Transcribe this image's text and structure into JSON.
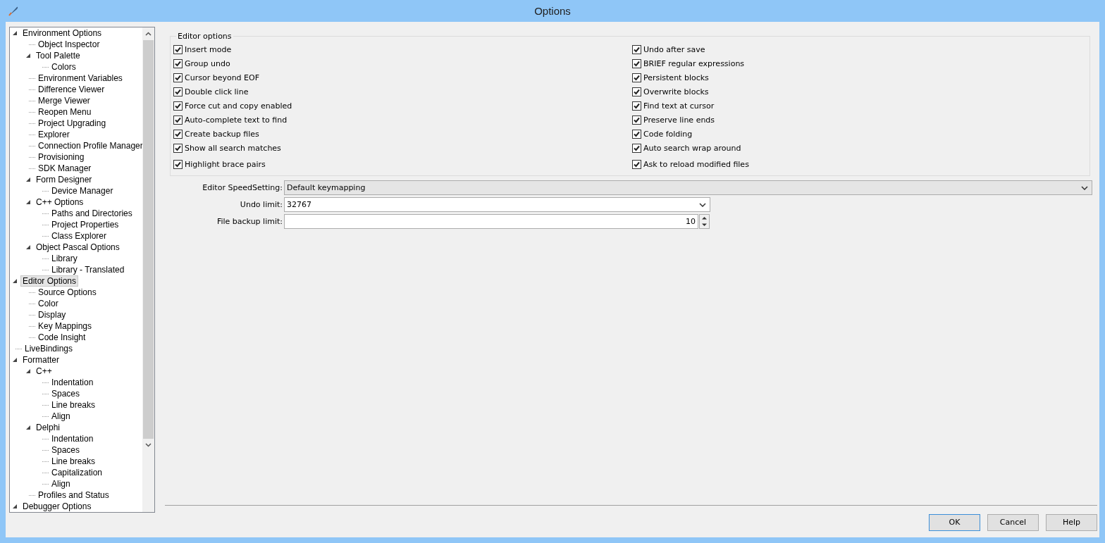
{
  "window": {
    "title": "Options"
  },
  "tree": [
    {
      "label": "Environment Options",
      "selected": false,
      "expanded": true,
      "children": [
        {
          "label": "Object Inspector",
          "selected": false
        },
        {
          "label": "Tool Palette",
          "selected": false,
          "expanded": true,
          "children": [
            {
              "label": "Colors",
              "selected": false
            }
          ]
        },
        {
          "label": "Environment Variables",
          "selected": false
        },
        {
          "label": "Difference Viewer",
          "selected": false
        },
        {
          "label": "Merge Viewer",
          "selected": false
        },
        {
          "label": "Reopen Menu",
          "selected": false
        },
        {
          "label": "Project Upgrading",
          "selected": false
        },
        {
          "label": "Explorer",
          "selected": false
        },
        {
          "label": "Connection Profile Manager",
          "selected": false
        },
        {
          "label": "Provisioning",
          "selected": false
        },
        {
          "label": "SDK Manager",
          "selected": false
        },
        {
          "label": "Form Designer",
          "selected": false,
          "expanded": true,
          "children": [
            {
              "label": "Device Manager",
              "selected": false
            }
          ]
        },
        {
          "label": "C++ Options",
          "selected": false,
          "expanded": true,
          "children": [
            {
              "label": "Paths and Directories",
              "selected": false
            },
            {
              "label": "Project Properties",
              "selected": false
            },
            {
              "label": "Class Explorer",
              "selected": false
            }
          ]
        },
        {
          "label": "Object Pascal Options",
          "selected": false,
          "expanded": true,
          "children": [
            {
              "label": "Library",
              "selected": false
            },
            {
              "label": "Library - Translated",
              "selected": false
            }
          ]
        }
      ]
    },
    {
      "label": "Editor Options",
      "selected": true,
      "expanded": true,
      "children": [
        {
          "label": "Source Options",
          "selected": false
        },
        {
          "label": "Color",
          "selected": false
        },
        {
          "label": "Display",
          "selected": false
        },
        {
          "label": "Key Mappings",
          "selected": false
        },
        {
          "label": "Code Insight",
          "selected": false
        }
      ]
    },
    {
      "label": "LiveBindings",
      "selected": false
    },
    {
      "label": "Formatter",
      "selected": false,
      "expanded": true,
      "children": [
        {
          "label": "C++",
          "selected": false,
          "expanded": true,
          "children": [
            {
              "label": "Indentation",
              "selected": false
            },
            {
              "label": "Spaces",
              "selected": false
            },
            {
              "label": "Line breaks",
              "selected": false
            },
            {
              "label": "Align",
              "selected": false
            }
          ]
        },
        {
          "label": "Delphi",
          "selected": false,
          "expanded": true,
          "children": [
            {
              "label": "Indentation",
              "selected": false
            },
            {
              "label": "Spaces",
              "selected": false
            },
            {
              "label": "Line breaks",
              "selected": false
            },
            {
              "label": "Capitalization",
              "selected": false
            },
            {
              "label": "Align",
              "selected": false
            }
          ]
        },
        {
          "label": "Profiles and Status",
          "selected": false
        }
      ]
    },
    {
      "label": "Debugger Options",
      "selected": false,
      "expanded": true
    }
  ],
  "editor_options": {
    "title": "Editor options",
    "checkboxes": [
      {
        "label": "Insert mode",
        "checked": true
      },
      {
        "label": "Undo after save",
        "checked": true
      },
      {
        "label": "Group undo",
        "checked": true
      },
      {
        "label": "BRIEF regular expressions",
        "checked": true
      },
      {
        "label": "Cursor beyond EOF",
        "checked": true
      },
      {
        "label": "Persistent blocks",
        "checked": true
      },
      {
        "label": "Double click line",
        "checked": true
      },
      {
        "label": "Overwrite blocks",
        "checked": true
      },
      {
        "label": "Force cut and copy enabled",
        "checked": true
      },
      {
        "label": "Find text at cursor",
        "checked": true
      },
      {
        "label": "Auto-complete text to find",
        "checked": true
      },
      {
        "label": "Preserve line ends",
        "checked": true
      },
      {
        "label": "Create backup files",
        "checked": true
      },
      {
        "label": "Code folding",
        "checked": true
      },
      {
        "label": "Show all search matches",
        "checked": true
      },
      {
        "label": "Auto search wrap around",
        "checked": true
      },
      {
        "label": "Highlight brace pairs",
        "checked": true
      },
      {
        "label": "Ask to reload modified files",
        "checked": true
      }
    ]
  },
  "fields": [
    {
      "kind": "readonly-dropdown",
      "label": "Editor SpeedSetting:",
      "value": "Default keymapping"
    },
    {
      "kind": "dropdown",
      "label": "Undo limit:",
      "value": "32767"
    },
    {
      "kind": "spinner",
      "label": "File backup limit:",
      "value": "10"
    }
  ],
  "buttons": [
    {
      "label": "OK",
      "default": true
    },
    {
      "label": "Cancel",
      "default": false
    },
    {
      "label": "Help",
      "default": false
    }
  ]
}
